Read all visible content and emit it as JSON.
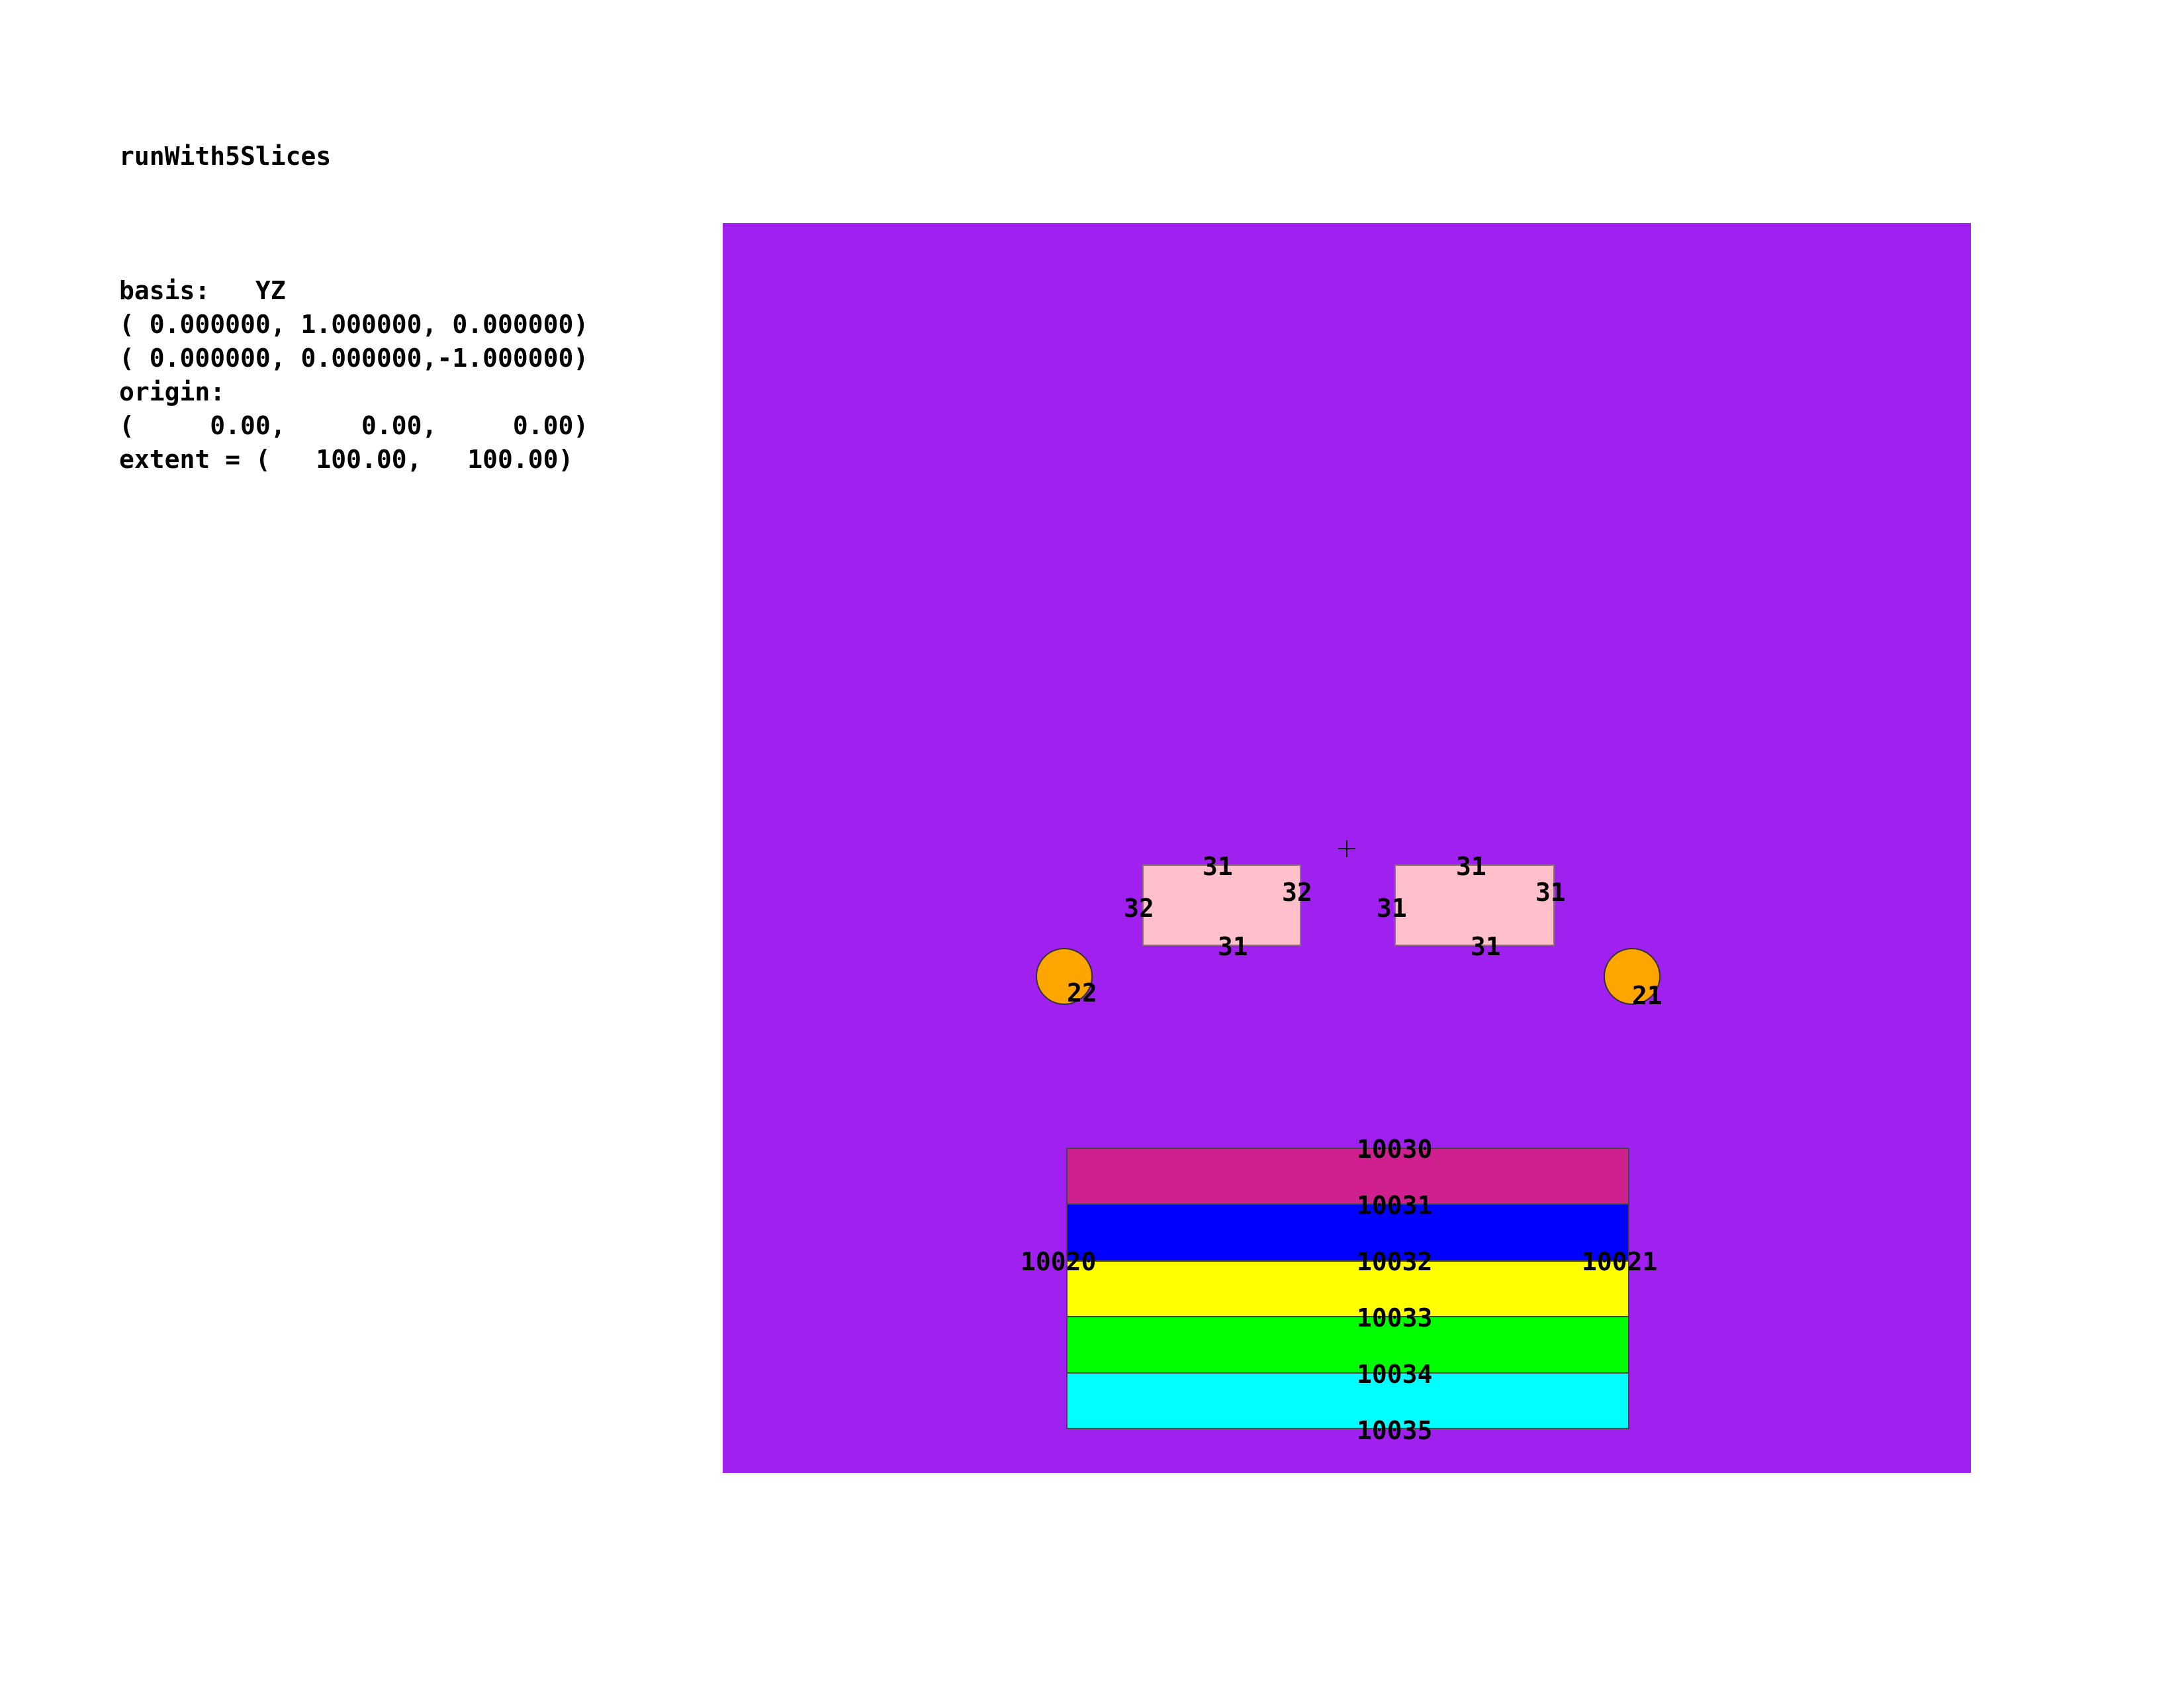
{
  "title": "runWith5Slices",
  "info": [
    "basis:   YZ",
    "( 0.000000, 1.000000, 0.000000)",
    "( 0.000000, 0.000000,-1.000000)",
    "origin:",
    "(     0.00,     0.00,     0.00)",
    "extent = (   100.00,   100.00)"
  ],
  "colors": {
    "background_region": "#a020f0",
    "rect_region": "#ffc0cb",
    "circle_region": "#ffa500",
    "slice_10030": "#d01f8f",
    "slice_10031": "#0000ff",
    "slice_10032": "#ffff00",
    "slice_10033": "#00ff00",
    "slice_10034": "#00ffff",
    "origin_marker": "crosshair"
  },
  "labels": {
    "rect_left_top": "31",
    "rect_left_left": "32",
    "rect_left_right": "32",
    "rect_left_bottom": "31",
    "rect_right_top": "31",
    "rect_right_left": "31",
    "rect_right_right": "31",
    "rect_right_bottom": "31",
    "circle_left": "22",
    "circle_right": "21",
    "stack_left": "10020",
    "stack_right": "10021",
    "slice_0": "10030",
    "slice_1": "10031",
    "slice_2": "10032",
    "slice_3": "10033",
    "slice_4": "10034",
    "slice_5": "10035"
  }
}
